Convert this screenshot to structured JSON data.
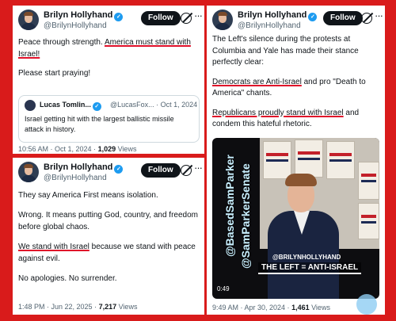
{
  "tweets": {
    "t1": {
      "name": "Brilyn Hollyhand",
      "handle": "@BrilynHollyhand",
      "follow_label": "Follow",
      "line1a": "Peace through strength. ",
      "line1b": "America must stand with Israel!",
      "line2": "Please start praying!",
      "quote": {
        "name": "Lucas Tomlin...",
        "handle": "@LucasFox... · Oct 1, 2024",
        "text": "Israel getting hit with the largest ballistic missile attack in history."
      },
      "meta_time": "10:56 AM · Oct 1, 2024 · ",
      "meta_views_count": "1,029",
      "meta_views_label": " Views"
    },
    "t2": {
      "name": "Brilyn Hollyhand",
      "handle": "@BrilynHollyhand",
      "follow_label": "Follow",
      "p1": "The Left's silence during the protests at Columbia and Yale has made their stance perfectly clear:",
      "p2a": "Democrats are Anti-Israel",
      "p2b": " and pro \"Death to America\" chants.",
      "p3a": "Republicans proudly stand with Israel",
      "p3b": " and condem this hateful rhetoric.",
      "video": {
        "label1": "@BasedSamParker",
        "label2": "@SamParkerSenate",
        "overlay_handle": "@BRILYNHOLLYHAND",
        "overlay_text": "THE LEFT = ANTI-ISRAEL",
        "time": "0:49"
      },
      "meta_time": "9:49 AM · Apr 30, 2024 · ",
      "meta_views_count": "1,461",
      "meta_views_label": " Views"
    },
    "t3": {
      "name": "Brilyn Hollyhand",
      "handle": "@BrilynHollyhand",
      "follow_label": "Follow",
      "p1": "They say America First means isolation.",
      "p2": "Wrong. It means putting God, country, and freedom before global chaos.",
      "p3a": "We stand with Israel",
      "p3b": " because we stand with peace against evil.",
      "p4": "No apologies. No surrender.",
      "meta_time": "1:48 PM · Jun 22, 2025 · ",
      "meta_views_count": "7,217",
      "meta_views_label": " Views"
    }
  },
  "icons": {
    "verified": "verified-badge-icon",
    "grok": "grok-icon",
    "more": "more-options-icon"
  },
  "colors": {
    "frame": "#d91b1b",
    "underline": "#e0102a",
    "follow_bg": "#0f1419",
    "verified": "#1d9bf0"
  }
}
